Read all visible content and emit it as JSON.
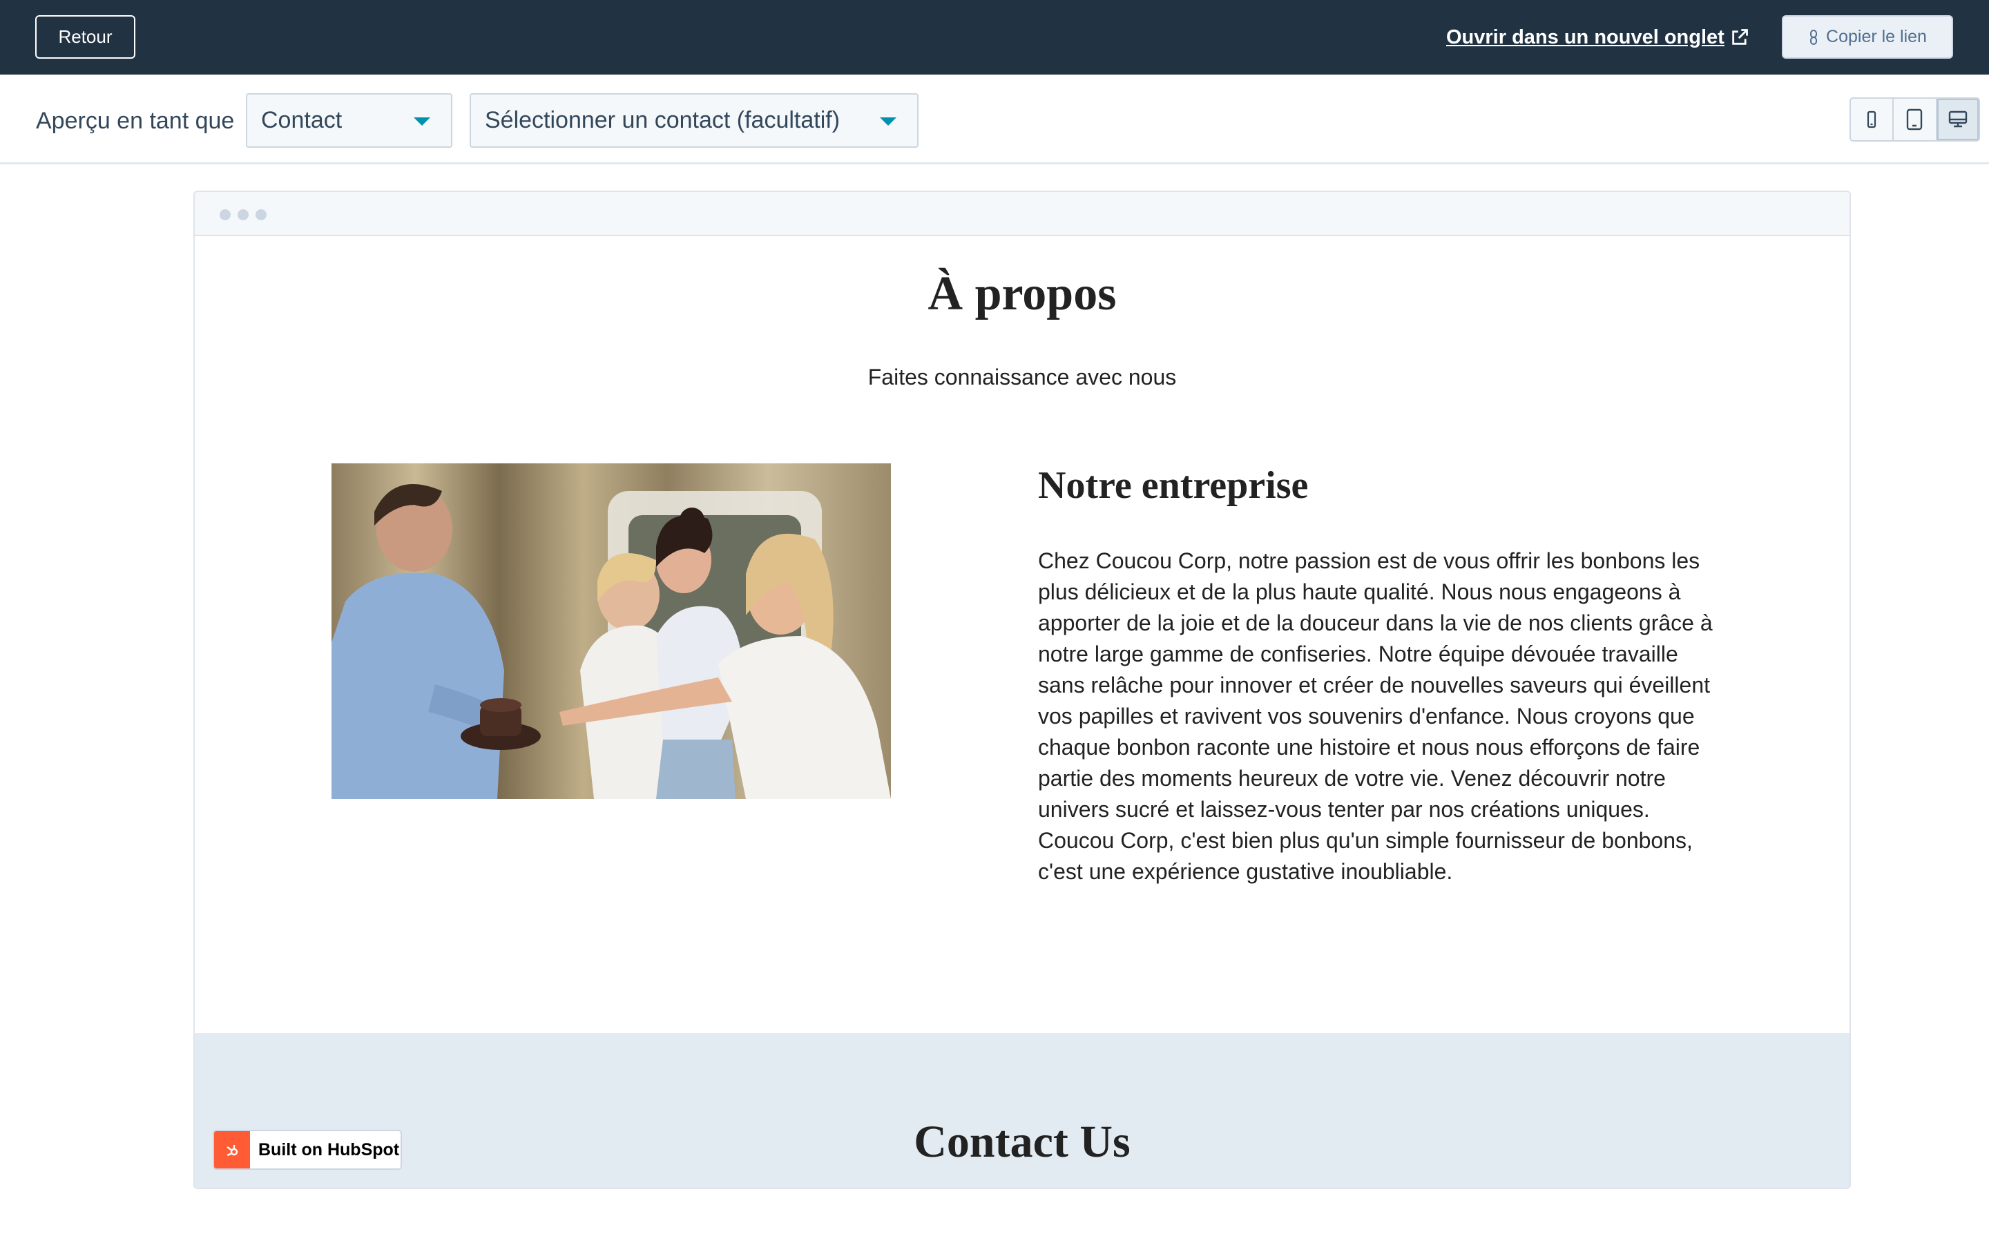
{
  "header": {
    "back_label": "Retour",
    "open_new_tab_label": "Ouvrir dans un nouvel onglet",
    "copy_link_label": "Copier le lien"
  },
  "toolbar": {
    "preview_as_label": "Aperçu en tant que",
    "type_select_value": "Contact",
    "contact_select_value": "Sélectionner un contact (facultatif)",
    "devices": [
      "mobile",
      "tablet",
      "desktop"
    ],
    "active_device": "desktop"
  },
  "preview": {
    "title": "À propos",
    "subtitle": "Faites connaissance avec nous",
    "section_title": "Notre entreprise",
    "section_body": "Chez Coucou Corp, notre passion est de vous offrir les bonbons les plus délicieux et de la plus haute qualité. Nous nous engageons à apporter de la joie et de la douceur dans la vie de nos clients grâce à notre large gamme de confiseries. Notre équipe dévouée travaille sans relâche pour innover et créer de nouvelles saveurs qui éveillent vos papilles et ravivent vos souvenirs d'enfance. Nous croyons que chaque bonbon raconte une histoire et nous nous efforçons de faire partie des moments heureux de votre vie. Venez découvrir notre univers sucré et laissez-vous tenter par nos créations uniques. Coucou Corp, c'est bien plus qu'un simple fournisseur de bonbons, c'est une expérience gustative inoubliable.",
    "contact_heading": "Contact Us",
    "badge_label": "Built on HubSpot"
  },
  "colors": {
    "header_bg": "#213343",
    "accent": "#0091ae",
    "hubspot_orange": "#ff5c35",
    "contact_band_bg": "#e3ebf2"
  }
}
